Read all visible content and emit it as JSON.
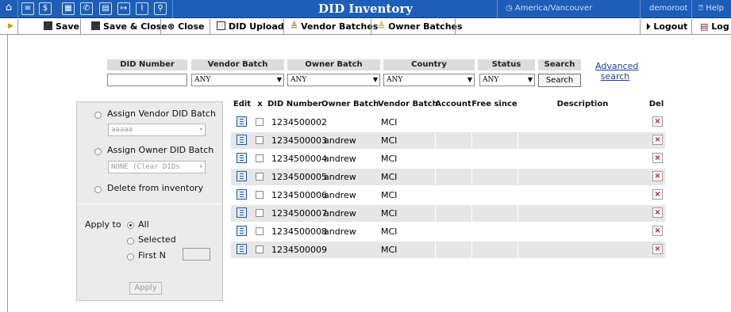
{
  "app": {
    "title": "DID Inventory",
    "timezone": "America/Vancouver",
    "user": "demoroot",
    "help": "Help"
  },
  "toolbar": {
    "save": "Save",
    "save_close": "Save & Close",
    "close": "Close",
    "did_upload": "DID Upload",
    "vendor_batches": "Vendor Batches",
    "owner_batches": "Owner Batches",
    "logout": "Logout",
    "log": "Log"
  },
  "filter": {
    "did_number_label": "DID Number",
    "vendor_batch_label": "Vendor Batch",
    "owner_batch_label": "Owner Batch",
    "country_label": "Country",
    "status_label": "Status",
    "search_label": "Search",
    "did_number_value": "",
    "vendor_batch_value": "ANY",
    "owner_batch_value": "ANY",
    "country_value": "ANY",
    "status_value": "ANY",
    "search_button": "Search",
    "advanced_search": "Advanced search"
  },
  "panel": {
    "assign_vendor": "Assign Vendor DID Batch",
    "vendor_select": "aaaaa",
    "assign_owner": "Assign Owner DID Batch",
    "owner_select": "NONE (Clear DIDs",
    "delete": "Delete from inventory",
    "apply_to": "Apply to",
    "all": "All",
    "selected": "Selected",
    "first_n": "First N",
    "first_n_value": "",
    "apply": "Apply"
  },
  "table": {
    "headers": {
      "edit": "Edit",
      "x": "x",
      "did_number": "DID Number",
      "owner_batch": "Owner Batch",
      "vendor_batch": "Vendor Batch",
      "account": "Account",
      "free_since": "Free since",
      "description": "Description",
      "del": "Del"
    },
    "rows": [
      {
        "did": "1234500002",
        "owner": "",
        "vendor": "MCI",
        "account": "",
        "free_since": "",
        "description": ""
      },
      {
        "did": "1234500003",
        "owner": "andrew",
        "vendor": "MCI",
        "account": "",
        "free_since": "",
        "description": ""
      },
      {
        "did": "1234500004",
        "owner": "andrew",
        "vendor": "MCI",
        "account": "",
        "free_since": "",
        "description": ""
      },
      {
        "did": "1234500005",
        "owner": "andrew",
        "vendor": "MCI",
        "account": "",
        "free_since": "",
        "description": ""
      },
      {
        "did": "1234500006",
        "owner": "andrew",
        "vendor": "MCI",
        "account": "",
        "free_since": "",
        "description": ""
      },
      {
        "did": "1234500007",
        "owner": "andrew",
        "vendor": "MCI",
        "account": "",
        "free_since": "",
        "description": ""
      },
      {
        "did": "1234500008",
        "owner": "andrew",
        "vendor": "MCI",
        "account": "",
        "free_since": "",
        "description": ""
      },
      {
        "did": "1234500009",
        "owner": "",
        "vendor": "MCI",
        "account": "",
        "free_since": "",
        "description": ""
      }
    ]
  }
}
